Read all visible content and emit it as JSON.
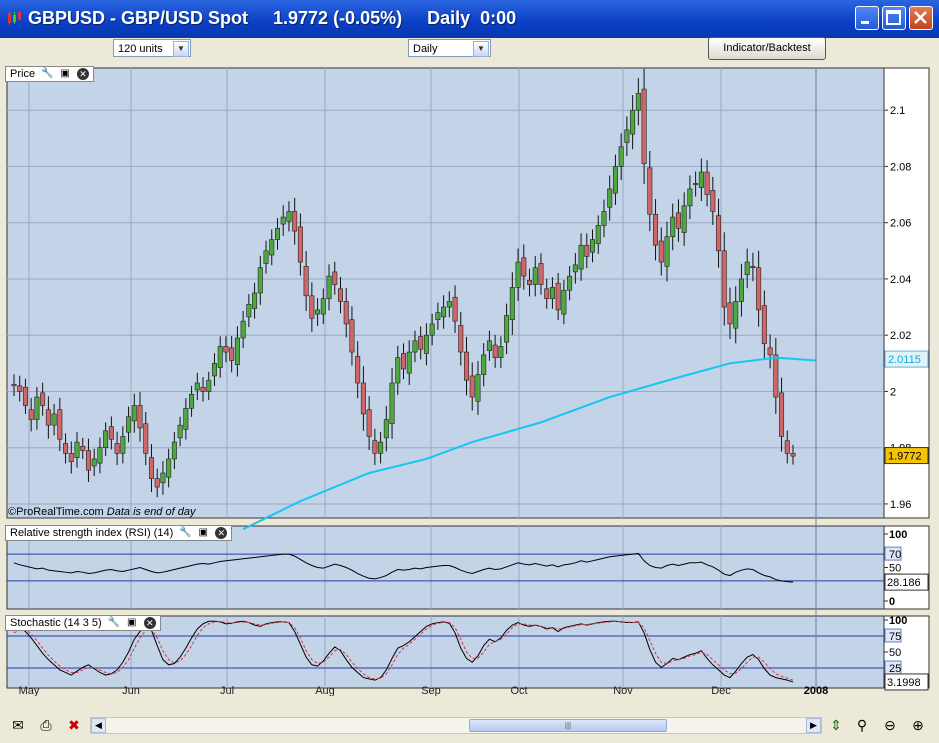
{
  "window": {
    "title": "GBPUSD - GBP/USD Spot     1.9772 (-0.05%)     Daily  0:00"
  },
  "toolbar": {
    "units_select": "120 units",
    "period_select": "Daily",
    "indicator_button": "Indicator/Backtest"
  },
  "panels": {
    "price_label": "Price",
    "rsi_label": "Relative strength index (RSI) (14)",
    "stoch_label": "Stochastic (14 3 5)",
    "watermark": "©ProRealTime.com",
    "watermark_note": "Data is end of day"
  },
  "colors": {
    "plot_bg": "#c3d3e8",
    "bull": "#4fa83f",
    "bear": "#d06666",
    "ma": "#17c5f1",
    "accent": "#0a3fc4"
  },
  "chart_data": [
    {
      "type": "candlestick",
      "title": "Price",
      "ylim": [
        1.955,
        2.115
      ],
      "y_ticks": [
        "2.1",
        "2.08",
        "2.06",
        "2.04",
        "2.02",
        "2",
        "1.98",
        "1.96"
      ],
      "x_labels": [
        "May",
        "Jun",
        "Jul",
        "Aug",
        "Sep",
        "Oct",
        "Nov",
        "Dec",
        "2008"
      ],
      "closes": [
        2.002,
        2.0,
        1.995,
        1.99,
        1.998,
        1.995,
        1.988,
        1.992,
        1.983,
        1.978,
        1.975,
        1.982,
        1.979,
        1.972,
        1.976,
        1.98,
        1.986,
        1.983,
        1.978,
        1.984,
        1.991,
        1.995,
        1.987,
        1.978,
        1.969,
        1.966,
        1.971,
        1.976,
        1.982,
        1.988,
        1.994,
        1.999,
        2.003,
        2.0,
        2.004,
        2.01,
        2.016,
        2.014,
        2.011,
        2.019,
        2.025,
        2.031,
        2.035,
        2.044,
        2.05,
        2.054,
        2.058,
        2.062,
        2.064,
        2.057,
        2.046,
        2.034,
        2.026,
        2.029,
        2.033,
        2.041,
        2.038,
        2.032,
        2.024,
        2.014,
        2.003,
        1.992,
        1.984,
        1.978,
        1.982,
        1.99,
        2.003,
        2.012,
        2.008,
        2.014,
        2.018,
        2.015,
        2.02,
        2.024,
        2.028,
        2.03,
        2.032,
        2.025,
        2.014,
        2.004,
        1.998,
        2.006,
        2.013,
        2.018,
        2.012,
        2.016,
        2.027,
        2.037,
        2.046,
        2.041,
        2.038,
        2.044,
        2.038,
        2.033,
        2.037,
        2.029,
        2.036,
        2.041,
        2.045,
        2.052,
        2.048,
        2.054,
        2.059,
        2.064,
        2.072,
        2.08,
        2.087,
        2.093,
        2.1,
        2.106,
        2.081,
        2.063,
        2.052,
        2.046,
        2.055,
        2.062,
        2.058,
        2.066,
        2.072,
        2.074,
        2.078,
        2.07,
        2.064,
        2.05,
        2.03,
        2.024,
        2.032,
        2.04,
        2.046,
        2.044,
        2.029,
        2.017,
        2.013,
        1.998,
        1.984,
        1.978,
        1.977
      ],
      "volatility": [
        0.006,
        0.006,
        0.005,
        0.007,
        0.006,
        0.006,
        0.008,
        0.006,
        0.007,
        0.006,
        0.007,
        0.006,
        0.005,
        0.007,
        0.006,
        0.006,
        0.005,
        0.006,
        0.007,
        0.006,
        0.006,
        0.007,
        0.008,
        0.007,
        0.008,
        0.006,
        0.007,
        0.006,
        0.006,
        0.005,
        0.006,
        0.005,
        0.006,
        0.006,
        0.005,
        0.006,
        0.006,
        0.006,
        0.007,
        0.007,
        0.006,
        0.006,
        0.006,
        0.007,
        0.006,
        0.006,
        0.006,
        0.007,
        0.006,
        0.008,
        0.008,
        0.009,
        0.008,
        0.007,
        0.006,
        0.007,
        0.006,
        0.007,
        0.008,
        0.008,
        0.009,
        0.01,
        0.008,
        0.007,
        0.006,
        0.008,
        0.009,
        0.007,
        0.006,
        0.007,
        0.006,
        0.006,
        0.007,
        0.006,
        0.006,
        0.007,
        0.006,
        0.007,
        0.008,
        0.009,
        0.008,
        0.008,
        0.007,
        0.006,
        0.006,
        0.006,
        0.007,
        0.009,
        0.008,
        0.008,
        0.007,
        0.007,
        0.006,
        0.006,
        0.006,
        0.006,
        0.006,
        0.006,
        0.007,
        0.007,
        0.007,
        0.006,
        0.006,
        0.007,
        0.008,
        0.007,
        0.008,
        0.008,
        0.009,
        0.009,
        0.012,
        0.01,
        0.009,
        0.008,
        0.009,
        0.008,
        0.008,
        0.008,
        0.008,
        0.007,
        0.008,
        0.007,
        0.008,
        0.01,
        0.011,
        0.009,
        0.009,
        0.009,
        0.008,
        0.008,
        0.01,
        0.009,
        0.008,
        0.01,
        0.009,
        0.006,
        0.005
      ],
      "ma_points": [
        [
          40,
          1.951
        ],
        [
          50,
          1.961
        ],
        [
          62,
          1.971
        ],
        [
          72,
          1.976
        ],
        [
          80,
          1.982
        ],
        [
          92,
          1.989
        ],
        [
          104,
          1.998
        ],
        [
          116,
          2.005
        ],
        [
          125,
          2.01
        ],
        [
          133,
          2.012
        ],
        [
          140,
          2.011
        ]
      ],
      "last_price_label": "1.9772",
      "ma_label": "2.0115"
    },
    {
      "type": "line",
      "title": "Relative strength index (RSI) (14)",
      "ylim": [
        0,
        100
      ],
      "y_ticks": [
        "100",
        "70",
        "50",
        "30",
        "0"
      ],
      "levels": [
        70,
        30
      ],
      "values": [
        57,
        54,
        52,
        50,
        48,
        49,
        46,
        45,
        44,
        43,
        42,
        44,
        43,
        41,
        42,
        44,
        46,
        47,
        45,
        44,
        46,
        48,
        50,
        47,
        44,
        42,
        43,
        45,
        47,
        49,
        51,
        53,
        55,
        56,
        55,
        57,
        59,
        60,
        61,
        62,
        63,
        64,
        65,
        66,
        67,
        68,
        69,
        70,
        70,
        67,
        62,
        57,
        53,
        50,
        49,
        52,
        55,
        53,
        50,
        46,
        41,
        37,
        34,
        33,
        35,
        38,
        43,
        47,
        46,
        47,
        49,
        48,
        50,
        51,
        52,
        53,
        53,
        50,
        46,
        43,
        41,
        44,
        47,
        49,
        47,
        48,
        51,
        54,
        57,
        55,
        54,
        56,
        54,
        52,
        54,
        51,
        54,
        55,
        57,
        60,
        58,
        60,
        62,
        64,
        66,
        67,
        68,
        69,
        70,
        71,
        60,
        53,
        50,
        49,
        53,
        55,
        53,
        55,
        57,
        57,
        58,
        54,
        51,
        46,
        40,
        38,
        43,
        46,
        48,
        47,
        42,
        38,
        36,
        32,
        30,
        29,
        28.186
      ],
      "last_label": "28.186"
    },
    {
      "type": "line",
      "title": "Stochastic (14 3 5)",
      "ylim": [
        0,
        100
      ],
      "y_ticks": [
        "100",
        "75",
        "50",
        "25",
        "0"
      ],
      "levels": [
        75,
        25
      ],
      "series": [
        {
          "values": [
            85,
            88,
            82,
            72,
            60,
            48,
            38,
            30,
            22,
            18,
            14,
            20,
            26,
            30,
            24,
            18,
            14,
            16,
            22,
            34,
            50,
            70,
            82,
            90,
            84,
            60,
            38,
            30,
            32,
            42,
            56,
            72,
            86,
            94,
            98,
            98,
            97,
            94,
            95,
            97,
            98,
            96,
            92,
            90,
            94,
            96,
            97,
            97,
            96,
            82,
            62,
            42,
            30,
            28,
            36,
            48,
            58,
            52,
            38,
            26,
            18,
            10,
            8,
            6,
            10,
            22,
            40,
            56,
            60,
            66,
            74,
            82,
            90,
            94,
            96,
            97,
            95,
            80,
            56,
            40,
            34,
            44,
            60,
            70,
            66,
            72,
            84,
            92,
            96,
            92,
            90,
            92,
            90,
            86,
            88,
            82,
            88,
            90,
            92,
            94,
            92,
            94,
            96,
            97,
            98,
            98,
            97,
            96,
            96,
            97,
            80,
            54,
            34,
            26,
            32,
            40,
            38,
            42,
            46,
            48,
            52,
            40,
            30,
            22,
            14,
            10,
            20,
            32,
            42,
            46,
            38,
            24,
            14,
            10,
            8,
            6,
            3.2
          ]
        },
        {
          "values": [
            80,
            84,
            85,
            78,
            68,
            56,
            45,
            36,
            28,
            22,
            18,
            18,
            22,
            26,
            26,
            22,
            18,
            16,
            18,
            26,
            38,
            56,
            72,
            84,
            86,
            72,
            52,
            38,
            33,
            36,
            46,
            60,
            76,
            88,
            94,
            97,
            98,
            96,
            95,
            96,
            97,
            96,
            94,
            92,
            93,
            95,
            96,
            97,
            96,
            88,
            72,
            52,
            38,
            32,
            34,
            42,
            52,
            54,
            46,
            34,
            24,
            16,
            10,
            8,
            9,
            16,
            30,
            46,
            56,
            62,
            70,
            78,
            86,
            92,
            95,
            96,
            96,
            88,
            70,
            50,
            40,
            40,
            50,
            62,
            66,
            70,
            78,
            88,
            94,
            94,
            92,
            92,
            90,
            88,
            88,
            86,
            87,
            89,
            91,
            93,
            93,
            94,
            95,
            96,
            97,
            98,
            97,
            97,
            96,
            96,
            88,
            68,
            48,
            34,
            32,
            36,
            38,
            40,
            44,
            46,
            50,
            46,
            38,
            30,
            22,
            16,
            17,
            24,
            34,
            42,
            42,
            34,
            24,
            16,
            12,
            9,
            6
          ]
        }
      ],
      "last_label": "3.1998"
    }
  ]
}
